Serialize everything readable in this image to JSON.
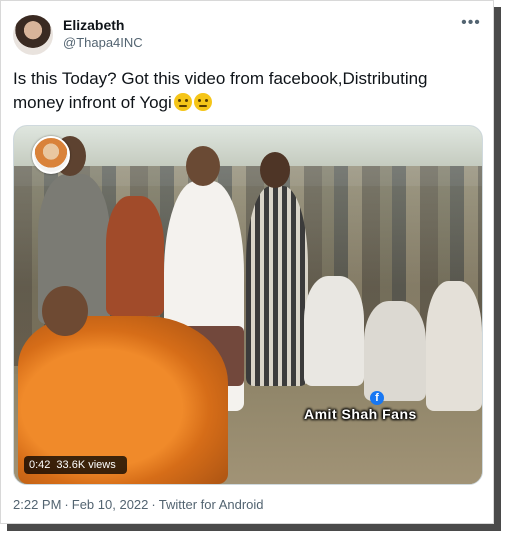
{
  "author": {
    "display_name": "Elizabeth",
    "handle": "@Thapa4INC"
  },
  "tweet": {
    "text": "Is this Today? Got this video from facebook,Distributing money infront of Yogi",
    "emojis": [
      "frowning-face-emoji",
      "frowning-face-emoji"
    ]
  },
  "media": {
    "watermark": "Amit Shah Fans",
    "duration": "0:42",
    "views": "33.6K views"
  },
  "footer": {
    "time": "2:22 PM",
    "date": "Feb 10, 2022",
    "source": "Twitter for Android",
    "separator": "·"
  },
  "icons": {
    "more": "more-options-icon",
    "platform_badge": "facebook-icon"
  },
  "colors": {
    "text_primary": "#0f1419",
    "text_secondary": "#536471",
    "facebook_blue": "#1877f2"
  }
}
